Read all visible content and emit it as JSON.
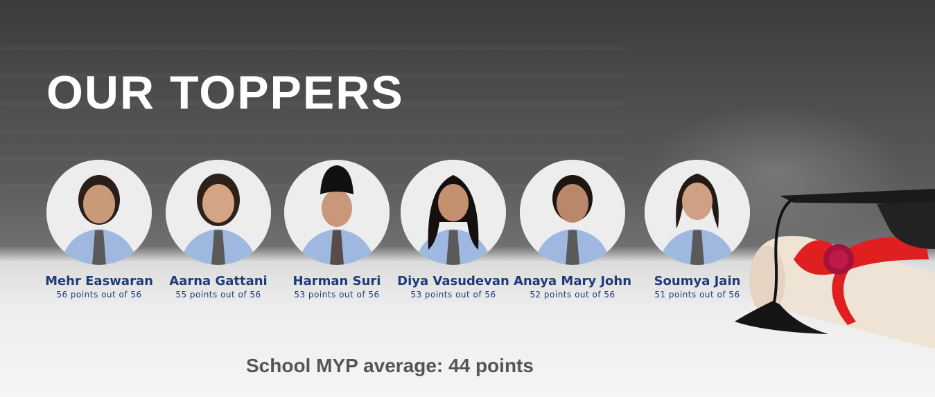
{
  "banner": {
    "title": "OUR TOPPERS",
    "average": "School MYP average: 44 points"
  },
  "toppers": [
    {
      "name": "Mehr Easwaran",
      "score": "56 points out of 56"
    },
    {
      "name": "Aarna Gattani",
      "score": "55 points out of 56"
    },
    {
      "name": "Harman Suri",
      "score": "53 points out of 56"
    },
    {
      "name": "Diya Vasudevan",
      "score": "53 points out of 56"
    },
    {
      "name": "Anaya Mary John",
      "score": "52 points out of 56"
    },
    {
      "name": "Soumya Jain",
      "score": "51 points out of 56"
    }
  ],
  "colors": {
    "name_text": "#1f3a7a",
    "shirt": "#9fb8e0",
    "ribbon": "#e02020"
  }
}
